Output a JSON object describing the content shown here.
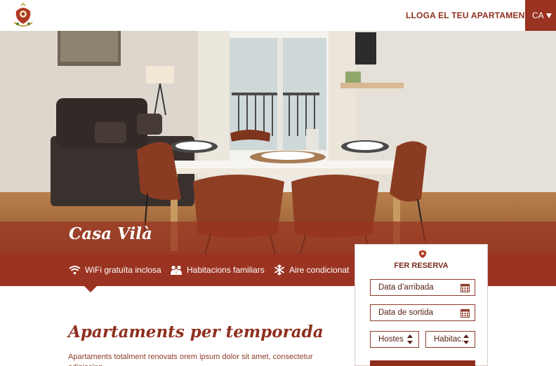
{
  "header": {
    "logo_icon": "crest-logo-icon",
    "cta_label": "LLOGA EL TEU APARTAMENT!",
    "language": "CA",
    "language_icon": "triangle-down-icon"
  },
  "hero": {
    "title": "Casa Vilà",
    "image": "apartment-dining-room-photo"
  },
  "amenities": [
    {
      "icon": "wifi-icon",
      "label": "WiFi gratuïta inclosa"
    },
    {
      "icon": "family-icon",
      "label": "Habitacions familiars"
    },
    {
      "icon": "snowflake-icon",
      "label": "Aire condicionat"
    }
  ],
  "booking": {
    "title": "FER RESERVA",
    "arrival_placeholder": "Data d’arribada",
    "departure_placeholder": "Data de sortida",
    "guests_label": "Hostes",
    "rooms_label": "Habitac."
  },
  "content": {
    "heading": "Apartaments per temporada",
    "paragraph": "Apartaments totalment renovats orem ipsum dolor sit amet, consectetur adipiscing"
  },
  "colors": {
    "brand": "#9a3321",
    "brand_dark": "#8e2f1e",
    "white": "#ffffff"
  }
}
